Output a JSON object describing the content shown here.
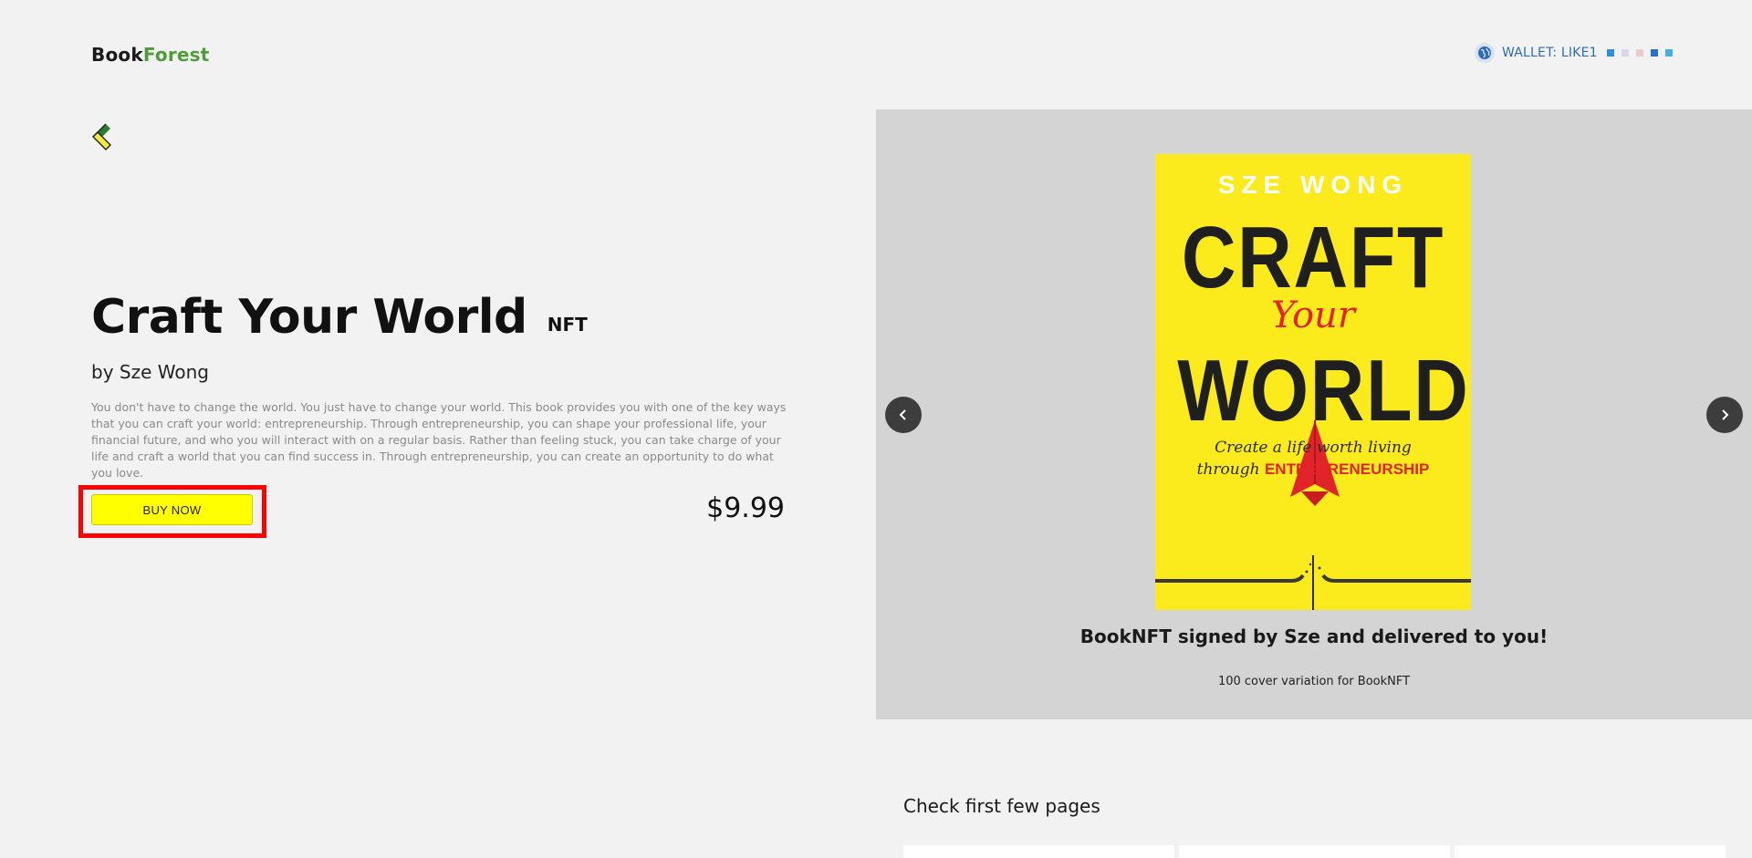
{
  "header": {
    "logo_part1": "Book",
    "logo_part2": "Forest",
    "wallet_label": "WALLET: LIKE1",
    "wallet_icon": "globe-icon",
    "wallet_squares": [
      "#2f8ee0",
      "#d9d9e6",
      "#f0c9cf",
      "#2a6fcf",
      "#41b0e6"
    ]
  },
  "nav": {
    "back_icon": "back-arrow-icon"
  },
  "book": {
    "title": "Craft Your World",
    "tag": "NFT",
    "author_line": "by Sze Wong",
    "description": "You don't have to change the world. You just have to change your world. This book provides you with one of the key ways that you can craft your world: entrepreneurship. Through entrepreneurship, you can shape your professional life, your financial future, and who you will interact with on a regular basis. Rather than feeling stuck, you can take charge of your life and craft a world that you can find success in. Through entrepreneurship, you can create an opportunity to do what you love.",
    "buy_label": "BUY NOW",
    "price": "$9.99"
  },
  "carousel": {
    "cover": {
      "author": "SZE WONG",
      "title_line1": "CRAFT",
      "title_word": "Your",
      "title_line2": "WORLD",
      "subtitle_line1": "Create a life worth living",
      "subtitle_line2_prefix": "through ",
      "subtitle_line2_highlight": "ENTREPRENEURSHIP",
      "colors": {
        "background": "#fbea1c",
        "accent": "#e0242a",
        "text": "#1f1f1f"
      }
    },
    "caption": "BookNFT signed by Sze and delivered to you!",
    "subcaption": "100 cover variation for BookNFT",
    "prev_icon": "chevron-left-icon",
    "next_icon": "chevron-right-icon"
  },
  "preview": {
    "title": "Check first few pages"
  },
  "colors": {
    "buy_button": "#ffff00",
    "highlight_box": "#ff0000",
    "carousel_bg": "#d4d4d4",
    "page_bg": "#f2f2f2"
  }
}
